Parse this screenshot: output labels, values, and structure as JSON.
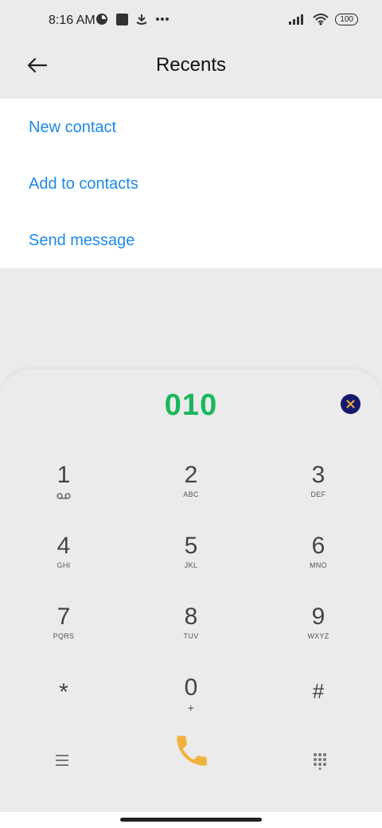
{
  "status": {
    "time": "8:16 AM",
    "battery": "100"
  },
  "header": {
    "title": "Recents"
  },
  "menu": {
    "items": [
      "New contact",
      "Add to contacts",
      "Send message"
    ]
  },
  "dialpad": {
    "number": "010",
    "keys": [
      {
        "digit": "1",
        "letters": ""
      },
      {
        "digit": "2",
        "letters": "ABC"
      },
      {
        "digit": "3",
        "letters": "DEF"
      },
      {
        "digit": "4",
        "letters": "GHI"
      },
      {
        "digit": "5",
        "letters": "JKL"
      },
      {
        "digit": "6",
        "letters": "MNO"
      },
      {
        "digit": "7",
        "letters": "PQRS"
      },
      {
        "digit": "8",
        "letters": "TUV"
      },
      {
        "digit": "9",
        "letters": "WXYZ"
      },
      {
        "digit": "*",
        "letters": ""
      },
      {
        "digit": "0",
        "letters": "+"
      },
      {
        "digit": "#",
        "letters": ""
      }
    ]
  },
  "colors": {
    "accent": "#1e88e5",
    "number": "#19b85c",
    "call": "#f0b23c",
    "clear_bg": "#161a6e",
    "clear_x": "#f0b23c"
  },
  "icons": {
    "back": "arrow-left-icon",
    "clear": "clear-icon",
    "voicemail": "voicemail-icon",
    "menu": "hamburger-icon",
    "call": "phone-icon",
    "keypad": "keypad-icon"
  }
}
